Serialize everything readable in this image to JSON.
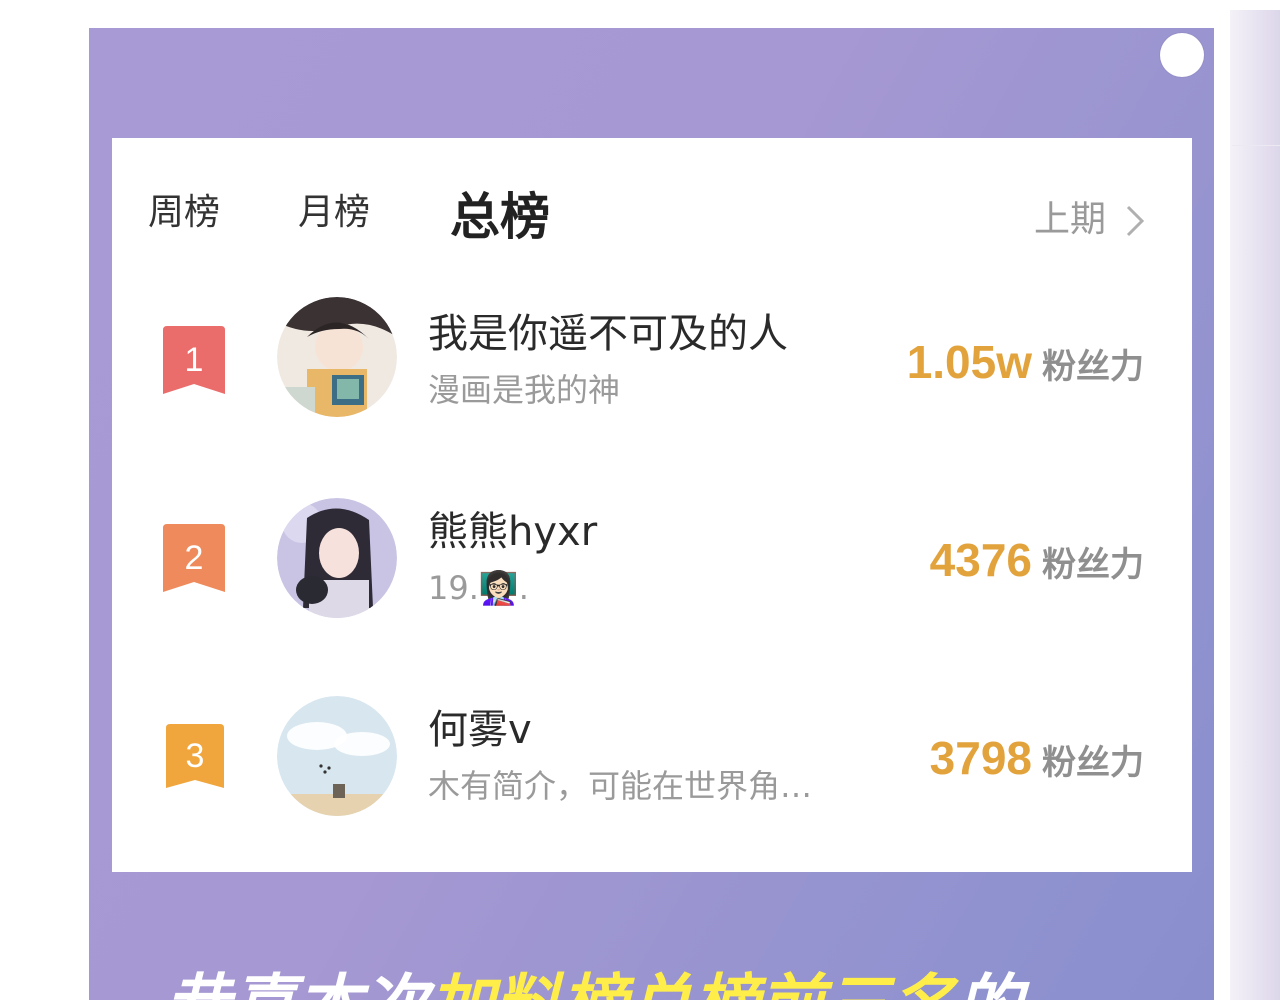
{
  "tabs": [
    {
      "label": "周榜"
    },
    {
      "label": "月榜"
    },
    {
      "label": "总榜"
    }
  ],
  "previous_label": "上期",
  "leaderboard": [
    {
      "rank": "1",
      "name": "我是你遥不可及的人",
      "bio": "漫画是我的神",
      "score": "1.05w",
      "unit": "粉丝力",
      "badge_color": "#ea6d6b"
    },
    {
      "rank": "2",
      "name": "熊熊hyxr",
      "bio": "19.👩🏻‍🏫.",
      "score": "4376",
      "unit": "粉丝力",
      "badge_color": "#ee8a5b"
    },
    {
      "rank": "3",
      "name": "何雾v",
      "bio": "木有简介，可能在世界角…",
      "score": "3798",
      "unit": "粉丝力",
      "badge_color": "#f0a63d"
    }
  ],
  "banner_text": {
    "white_part": "恭喜本次",
    "yellow_part": "加料榜总榜前三名",
    "tail": "的"
  },
  "colors": {
    "accent": "#e2a33d",
    "banner": "#a698d2"
  }
}
